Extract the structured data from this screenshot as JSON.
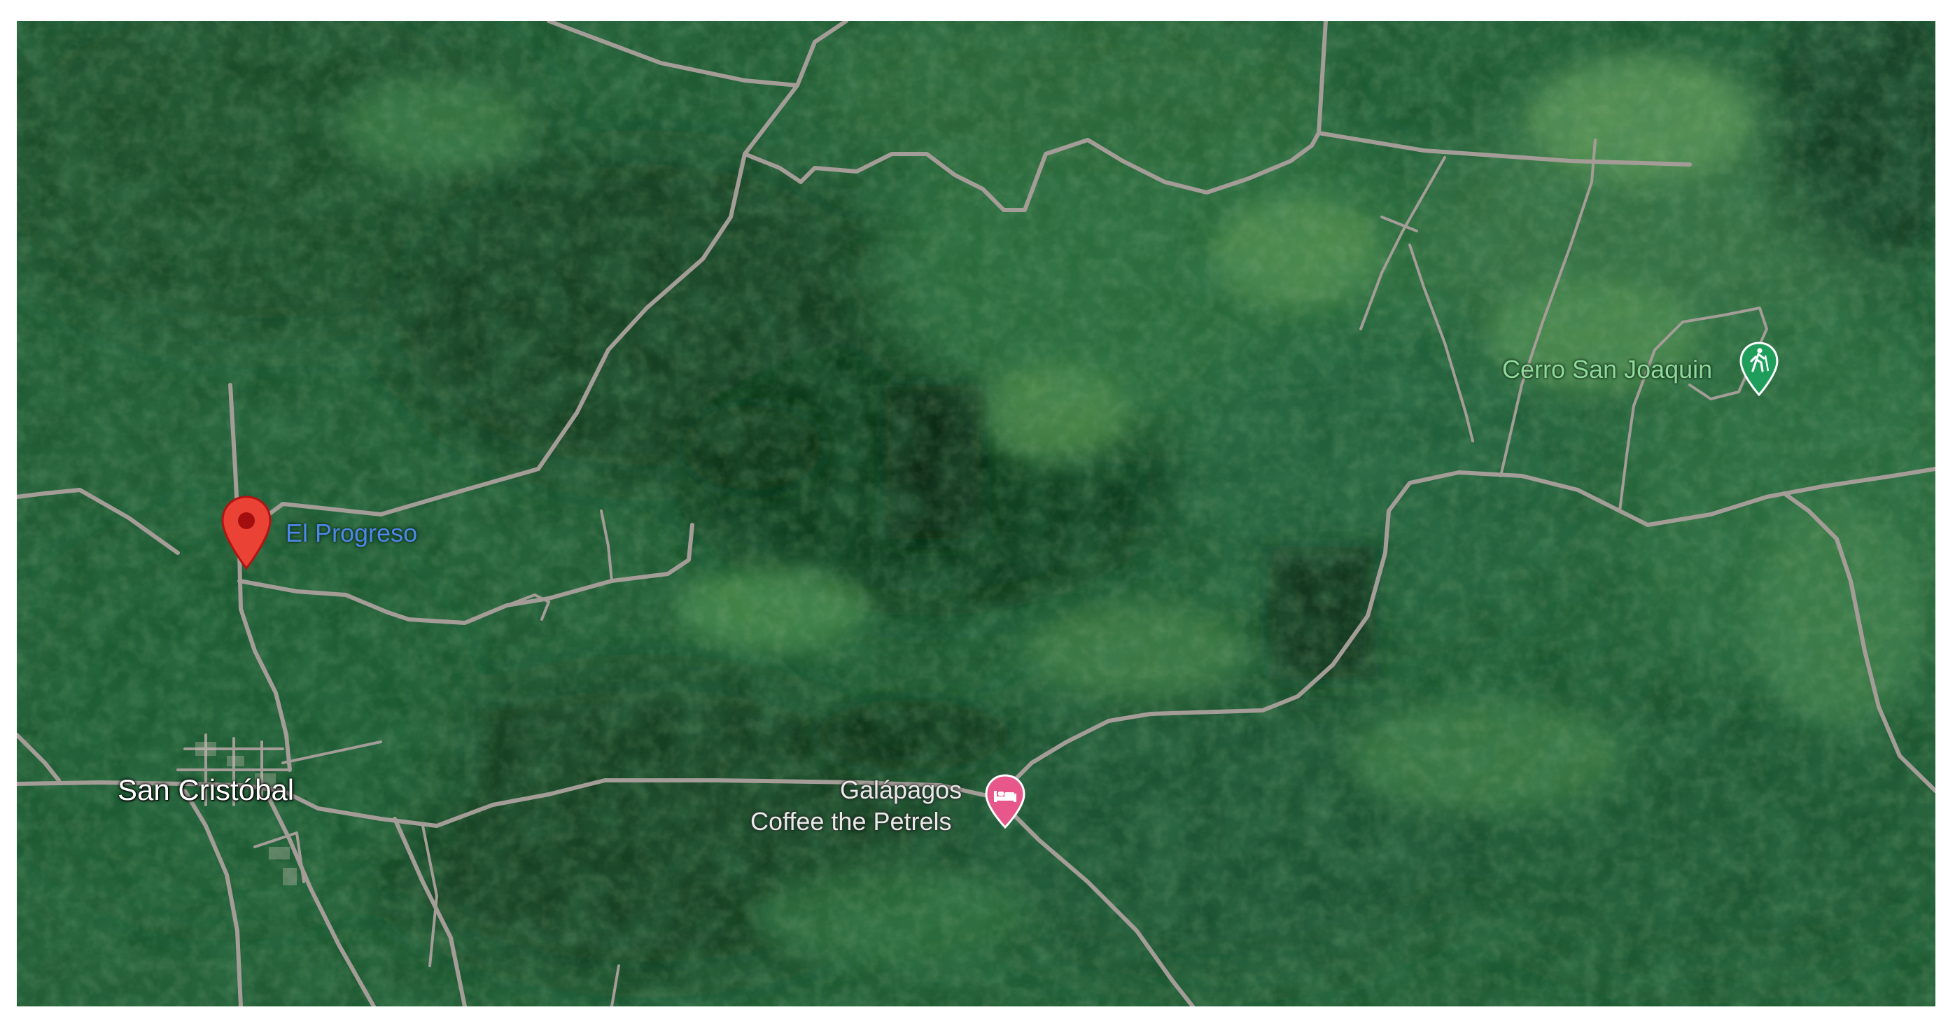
{
  "places": {
    "el_progreso": "El Progreso",
    "san_cristobal": "San Cristóbal",
    "galapagos_line1": "Galápagos",
    "galapagos_line2": "Coffee the Petrels",
    "cerro_san_joaquin": "Cerro San Joaquin"
  },
  "icons": {
    "location_pin": "map-pin-icon",
    "lodging": "bed-icon",
    "hiking": "hiking-icon"
  },
  "colors": {
    "pin_red": "#ea4335",
    "lodging_pink": "#e8578a",
    "hiking_green": "#1e9e5a",
    "road": "#a49d97",
    "vegetation": "#1f5a33"
  }
}
